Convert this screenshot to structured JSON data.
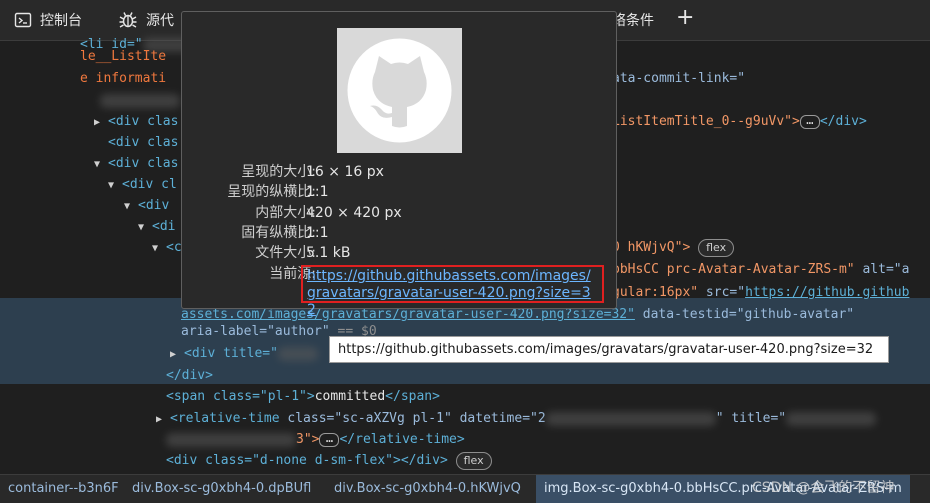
{
  "toolbar": {
    "tabs": [
      {
        "label": "控制台",
        "icon": "console-icon"
      },
      {
        "label": "源代",
        "icon": "bug-icon"
      },
      {
        "label": "络条件",
        "icon": ""
      }
    ],
    "add_label": "+"
  },
  "code": {
    "l0": "le__ListIte",
    "l1": "e informati",
    "l1b": "ata-commit-link=\"",
    "l3": "<div clas",
    "l3b": "ListItemTitle_0--g9uVv\">",
    "l3c": "</div>",
    "l4": "<div clas",
    "l5": "<div clas",
    "l6": "<div cl",
    "l7": "<div",
    "l8": "<di",
    "l9": "<c",
    "l9b": "0 hKWjvQ\">",
    "l10a": "bbHsCC prc-Avatar-Avatar-ZRS-m\"",
    "l10b": " alt=\"a",
    "l11a": "gular:16px\"",
    "l11b": " src=\"",
    "l11c": "https://github.github",
    "l12a": "assets.com/images/gravatars/gravatar-user-420.png?size=32\"",
    "l12b": " data-testid=\"github-avatar\"",
    "l13a": "aria-label=\"author\"",
    "l13b": " == $0",
    "l14": "<div title=\"",
    "l15": "</div>",
    "l16a": "<span class=\"pl-1\">",
    "l16b": "committed",
    "l16c": "</span>",
    "l17a": "<relative-time",
    "l17b": " class=\"sc-aXZVg pl-1\"",
    "l17c": " datetime=\"2",
    "l17d": "\" title=\"",
    "l18a": "3\">",
    "l18b": "</relative-time>",
    "l19a": "<div class=\"d-none d-sm-flex\">",
    "l19b": "</div>",
    "flex_badge": "flex",
    "ellipsis": "…"
  },
  "popover": {
    "rows": [
      {
        "label": "呈现的大小:",
        "value": "16 × 16 px"
      },
      {
        "label": "呈现的纵横比:",
        "value": "1:1"
      },
      {
        "label": "内部大小:",
        "value": "420 × 420 px"
      },
      {
        "label": "固有纵横比:",
        "value": "1:1"
      },
      {
        "label": "文件大小:",
        "value": "5.1 kB"
      }
    ],
    "source_label": "当前源:",
    "source_url": "https://github.githubassets.com/images/gravatars/gravatar-user-420.png?size=32"
  },
  "tooltip": {
    "text": "https://github.githubassets.com/images/gravatars/gravatar-user-420.png?size=32"
  },
  "breadcrumbs": [
    "container--b3n6F",
    "div.Box-sc-g0xbh4-0.dpBUfl",
    "div.Box-sc-g0xbh4-0.hKWjvQ",
    "img.Box-sc-g0xbh4-0.bbHsCC.prc-Avatar-Avatar-ZRS-m"
  ],
  "watermark": "CSDN @会飞的不留神",
  "colors": {
    "background": "#1f1f1f",
    "tag": "#5db0d7",
    "attr_value": "#f29766",
    "highlight_border": "#e02020",
    "selected_row": "#2d3f4f"
  }
}
